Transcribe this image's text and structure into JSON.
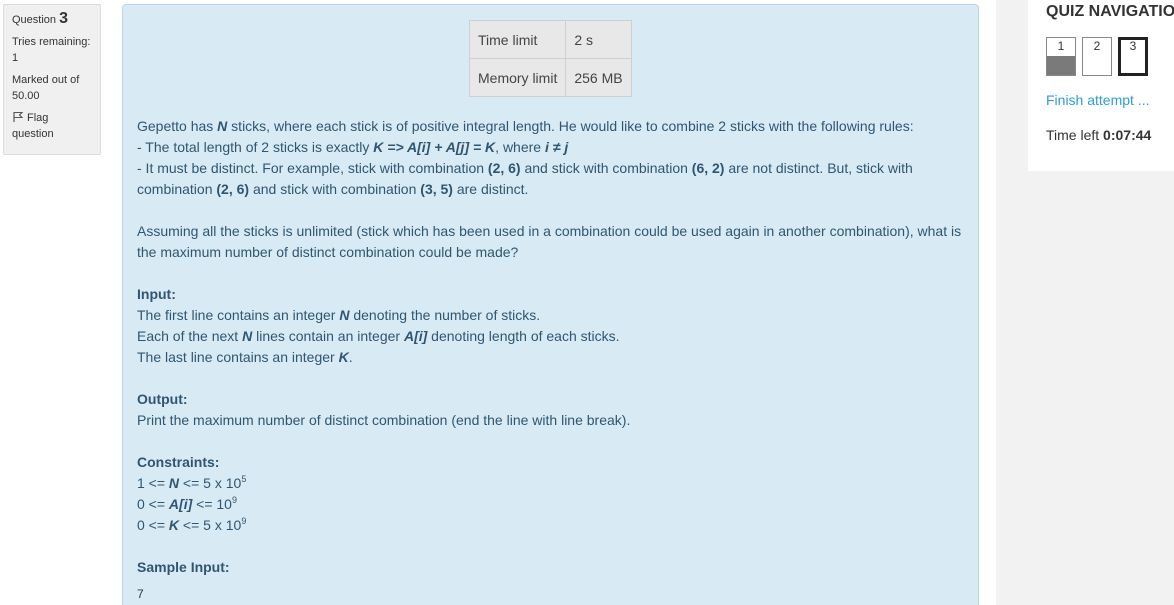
{
  "info": {
    "question_label": "Question",
    "question_number": "3",
    "tries_label": "Tries remaining:",
    "tries_value": "1",
    "marked_label": "Marked out of",
    "marked_value": "50.00",
    "flag_line1": "Flag",
    "flag_line2": "question"
  },
  "limits": {
    "time_label": "Time limit",
    "time_value": "2 s",
    "memory_label": "Memory limit",
    "memory_value": "256 MB"
  },
  "question": {
    "intro_1": "Gepetto has ",
    "var_N": "N",
    "intro_2": " sticks, where each stick is of positive integral length. He would like to combine 2 sticks with the following rules:",
    "rule1_a": "- The total length of 2 sticks is exactly ",
    "rule1_formula": "K => A[i] + A[j] = K",
    "rule1_b": ", where ",
    "rule1_cond": "i ≠ j",
    "rule2_a": "- It must be distinct. For example, stick with combination ",
    "combo_26": "(2, 6)",
    "rule2_b": " and stick with combination ",
    "combo_62": "(6, 2)",
    "rule2_c": " are not distinct. But, stick with combination ",
    "rule2_d": " and stick with combination ",
    "combo_35": "(3, 5)",
    "rule2_e": " are distinct.",
    "assume": "Assuming all the sticks is unlimited (stick which has been used in a combination could be used again in another combination), what is the maximum number of distinct combination could be made?",
    "input_head": "Input:",
    "input_1a": "The first line contains an integer ",
    "input_1b": " denoting the number of sticks.",
    "input_2a": "Each of the next ",
    "input_2b": " lines contain an integer ",
    "var_Ai": "A[i]",
    "input_2c": " denoting length of each sticks.",
    "input_3a": "The last line contains an integer ",
    "var_K": "K",
    "input_3b": ".",
    "output_head": "Output:",
    "output_text": "Print the maximum number of distinct combination (end the line with line break).",
    "constraints_head": "Constraints:",
    "c1_a": "1 <= ",
    "c1_b": " <= 5 x 10",
    "c1_exp": "5",
    "c2_a": "0 <= ",
    "c2_b": " <= 10",
    "c2_exp": "9",
    "c3_a": "0 <= ",
    "c3_b": " <= 5 x 10",
    "c3_exp": "9",
    "sample_head": "Sample Input:",
    "sample_first": "7"
  },
  "nav": {
    "title": "QUIZ NAVIGATIO",
    "buttons": [
      {
        "label": "1",
        "state": "answered"
      },
      {
        "label": "2",
        "state": "unanswered"
      },
      {
        "label": "3",
        "state": "current"
      }
    ],
    "finish": "Finish attempt ...",
    "time_label": "Time left ",
    "time_value": "0:07:44"
  },
  "colors": {
    "content_bg": "#d8ebf5",
    "text_blue": "#2f5671",
    "link": "#2a9fd6"
  }
}
